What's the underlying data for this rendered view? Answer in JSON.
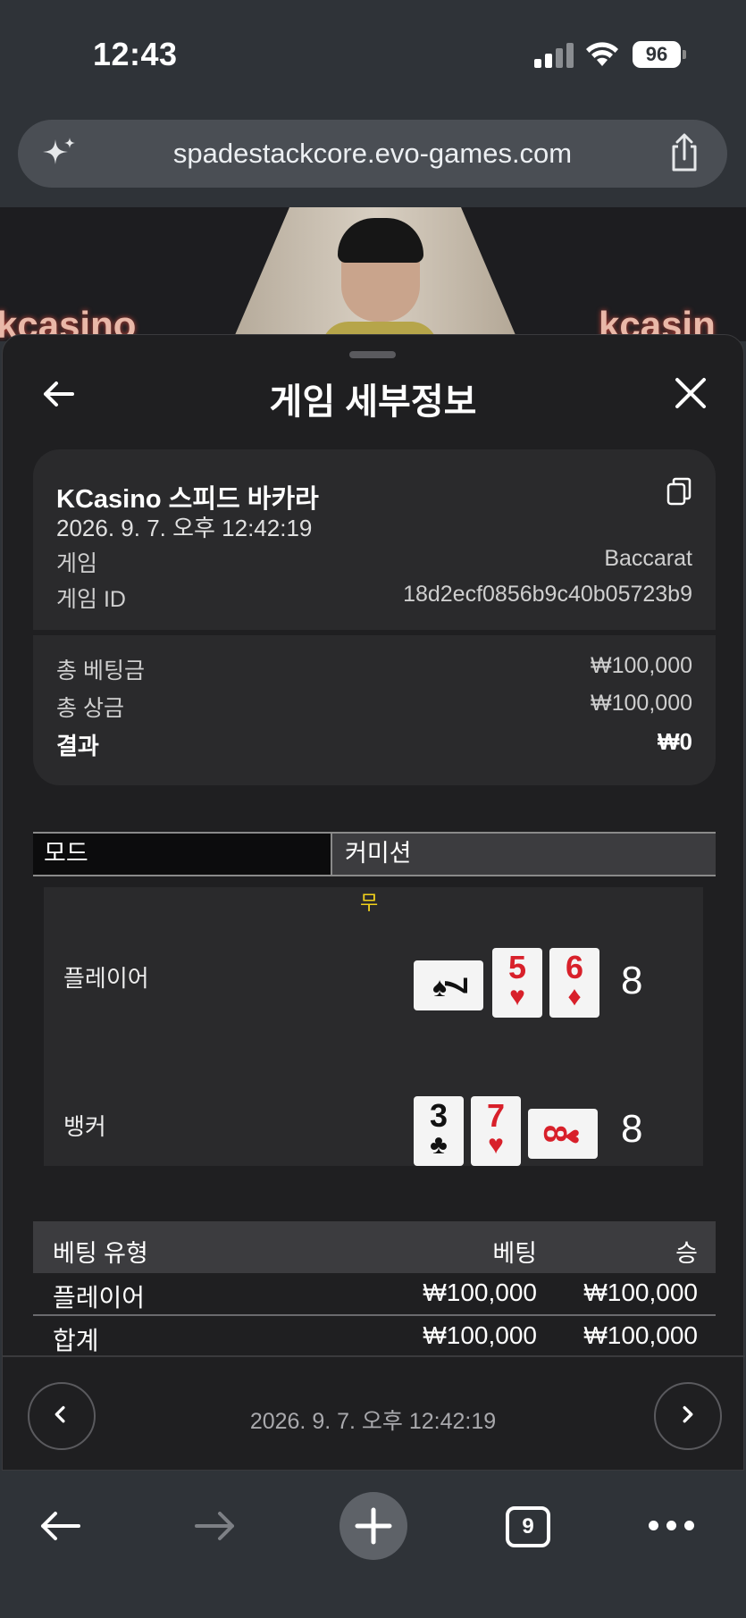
{
  "status_bar": {
    "time": "12:43",
    "battery": "96"
  },
  "browser": {
    "url": "spadestackcore.evo-games.com",
    "tab_count": "9"
  },
  "video": {
    "logo_left": "kcasino",
    "logo_right": "kcasin"
  },
  "sheet": {
    "title": "게임 세부정보",
    "summary": {
      "game_name": "KCasino 스피드 바카라",
      "date": "2026. 9. 7. 오후 12:42:19",
      "rows": [
        {
          "label": "게임",
          "value": "Baccarat"
        },
        {
          "label": "게임 ID",
          "value": "18d2ecf0856b9c40b05723b9"
        }
      ],
      "totals": [
        {
          "label": "총 베팅금",
          "value": "₩100,000"
        },
        {
          "label": "총 상금",
          "value": "₩100,000"
        }
      ],
      "result": {
        "label": "결과",
        "value": "₩0"
      }
    },
    "mode": {
      "mode_label": "모드",
      "commission_label": "커미션"
    },
    "board": {
      "outcome": "무",
      "player": {
        "label": "플레이어",
        "score": "8",
        "cards": [
          {
            "rank": "7",
            "suit": "♠"
          },
          {
            "rank": "5",
            "suit": "♥"
          },
          {
            "rank": "6",
            "suit": "♦"
          }
        ]
      },
      "banker": {
        "label": "뱅커",
        "score": "8",
        "cards": [
          {
            "rank": "3",
            "suit": "♣"
          },
          {
            "rank": "7",
            "suit": "♥"
          },
          {
            "rank": "8",
            "suit": "♥"
          }
        ]
      }
    },
    "bets": {
      "headers": {
        "type": "베팅 유형",
        "bet": "베팅",
        "win": "승"
      },
      "rows": [
        {
          "type": "플레이어",
          "bet": "₩100,000",
          "win": "₩100,000"
        }
      ],
      "total": {
        "type": "합계",
        "bet": "₩100,000",
        "win": "₩100,000"
      }
    },
    "pager": {
      "date": "2026. 9. 7. 오후 12:42:19"
    }
  },
  "icons": [
    "sparkle-icon",
    "share-icon",
    "back-arrow-icon",
    "close-icon",
    "copy-icon",
    "chevron-left-icon",
    "chevron-right-icon",
    "plus-icon",
    "more-icon"
  ]
}
